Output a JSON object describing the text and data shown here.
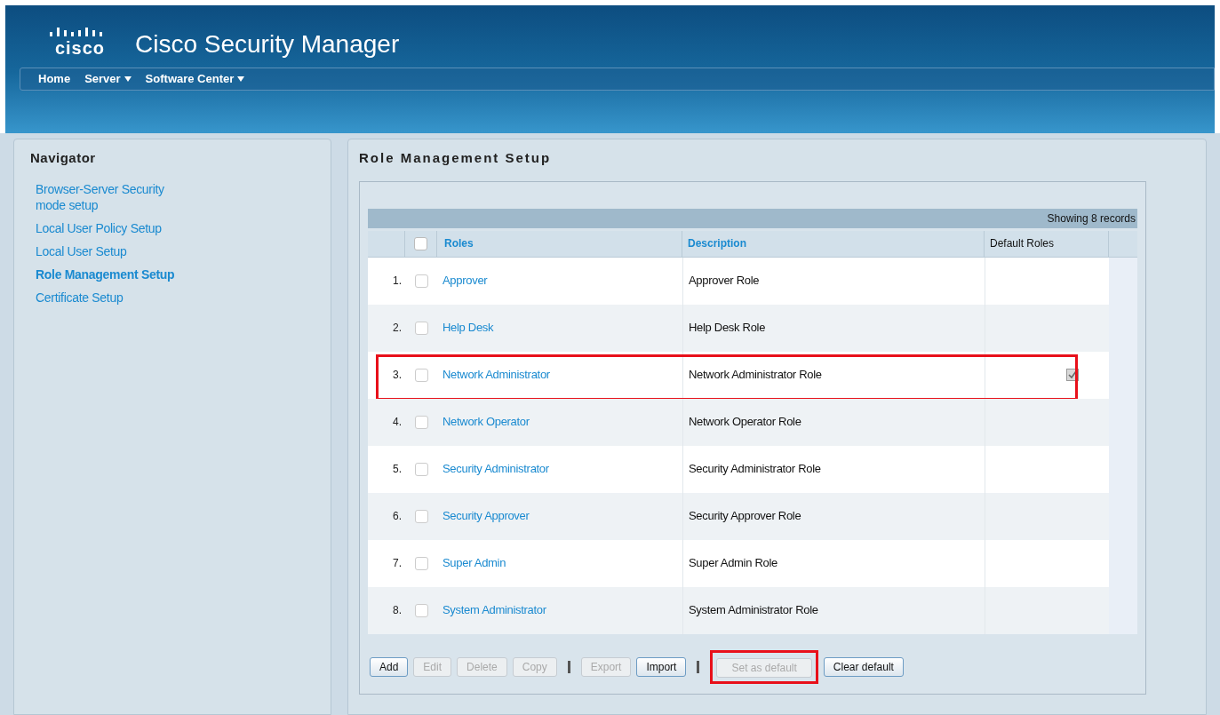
{
  "header": {
    "logo": "cisco",
    "title": "Cisco Security Manager",
    "menu": [
      {
        "label": "Home",
        "dropdown": false
      },
      {
        "label": "Server",
        "dropdown": true
      },
      {
        "label": "Software Center",
        "dropdown": true
      }
    ]
  },
  "navigator": {
    "title": "Navigator",
    "items": [
      {
        "label": "Browser-Server Security mode setup",
        "selected": false
      },
      {
        "label": "Local User Policy Setup",
        "selected": false
      },
      {
        "label": "Local User Setup",
        "selected": false
      },
      {
        "label": "Role Management Setup",
        "selected": true
      },
      {
        "label": "Certificate Setup",
        "selected": false
      }
    ]
  },
  "main": {
    "title": "Role Management Setup",
    "record_count": "Showing 8 records",
    "table": {
      "columns": [
        "Roles",
        "Description",
        "Default Roles"
      ],
      "select_all_checked": false,
      "rows": [
        {
          "number": "1.",
          "role": "Approver",
          "description": "Approver Role",
          "checked": false,
          "default": false,
          "highlighted": false
        },
        {
          "number": "2.",
          "role": "Help Desk",
          "description": "Help Desk Role",
          "checked": false,
          "default": false,
          "highlighted": false
        },
        {
          "number": "3.",
          "role": "Network Administrator",
          "description": "Network Administrator Role",
          "checked": false,
          "default": true,
          "highlighted": true
        },
        {
          "number": "4.",
          "role": "Network Operator",
          "description": "Network Operator Role",
          "checked": false,
          "default": false,
          "highlighted": false
        },
        {
          "number": "5.",
          "role": "Security Administrator",
          "description": "Security Administrator Role",
          "checked": false,
          "default": false,
          "highlighted": false
        },
        {
          "number": "6.",
          "role": "Security Approver",
          "description": "Security Approver Role",
          "checked": false,
          "default": false,
          "highlighted": false
        },
        {
          "number": "7.",
          "role": "Super Admin",
          "description": "Super Admin Role",
          "checked": false,
          "default": false,
          "highlighted": false
        },
        {
          "number": "8.",
          "role": "System Administrator",
          "description": "System Administrator Role",
          "checked": false,
          "default": false,
          "highlighted": false
        }
      ]
    },
    "buttons": [
      {
        "kind": "button",
        "label": "Add",
        "disabled": false,
        "highlighted": false
      },
      {
        "kind": "button",
        "label": "Edit",
        "disabled": true,
        "highlighted": false
      },
      {
        "kind": "button",
        "label": "Delete",
        "disabled": true,
        "highlighted": false
      },
      {
        "kind": "button",
        "label": "Copy",
        "disabled": true,
        "highlighted": false
      },
      {
        "kind": "separator"
      },
      {
        "kind": "button",
        "label": "Export",
        "disabled": true,
        "highlighted": false
      },
      {
        "kind": "button",
        "label": "Import",
        "disabled": false,
        "highlighted": false
      },
      {
        "kind": "separator"
      },
      {
        "kind": "button",
        "label": "Set as default",
        "disabled": true,
        "highlighted": true
      },
      {
        "kind": "button",
        "label": "Clear default",
        "disabled": false,
        "highlighted": false
      }
    ]
  }
}
